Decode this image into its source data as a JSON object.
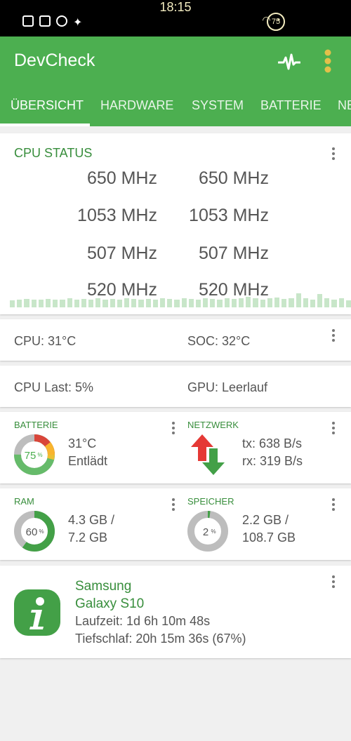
{
  "status_bar": {
    "time": "18:15",
    "battery_level": "75"
  },
  "app": {
    "title": "DevCheck",
    "brand_color": "#4caf50",
    "accent_dark": "#388e3c"
  },
  "tabs": [
    {
      "label": "ÜBERSICHT",
      "active": true
    },
    {
      "label": "HARDWARE"
    },
    {
      "label": "SYSTEM"
    },
    {
      "label": "BATTERIE"
    },
    {
      "label": "NE"
    }
  ],
  "cpu_status": {
    "title": "CPU STATUS",
    "frequencies": [
      "650 MHz",
      "650 MHz",
      "1053 MHz",
      "1053 MHz",
      "507 MHz",
      "507 MHz",
      "520 MHz",
      "520 MHz"
    ],
    "load_history": [
      0.45,
      0.5,
      0.55,
      0.5,
      0.5,
      0.55,
      0.5,
      0.5,
      0.6,
      0.5,
      0.55,
      0.5,
      0.6,
      0.5,
      0.55,
      0.5,
      0.6,
      0.55,
      0.5,
      0.55,
      0.5,
      0.6,
      0.55,
      0.5,
      0.6,
      0.55,
      0.5,
      0.6,
      0.55,
      0.5,
      0.6,
      0.55,
      0.6,
      0.7,
      0.6,
      0.5,
      0.6,
      0.65,
      0.55,
      0.6,
      0.9,
      0.6,
      0.5,
      0.85,
      0.6,
      0.5,
      0.6,
      0.45
    ]
  },
  "temps": {
    "cpu": "CPU: 31°C",
    "soc": "SOC: 32°C"
  },
  "load": {
    "cpu": "CPU Last: 5%",
    "gpu": "GPU: Leerlauf"
  },
  "battery": {
    "title": "BATTERIE",
    "percent": 75,
    "percent_label": "75",
    "percent_sign": "%",
    "temp": "31°C",
    "state": "Entlädt"
  },
  "network": {
    "title": "NETZWERK",
    "tx": "tx: 638 B/s",
    "rx": "rx: 319 B/s"
  },
  "ram": {
    "title": "RAM",
    "percent": 60,
    "percent_label": "60",
    "percent_sign": "%",
    "used": "4.3 GB /",
    "total": "7.2 GB"
  },
  "storage": {
    "title": "SPEICHER",
    "percent": 2,
    "percent_label": "2",
    "percent_sign": "%",
    "used": "2.2 GB /",
    "total": "108.7 GB"
  },
  "device": {
    "brand": "Samsung",
    "model": "Galaxy S10",
    "uptime": "Laufzeit: 1d 6h 10m 48s",
    "deep_sleep": "Tiefschlaf: 20h 15m 36s (67%)"
  }
}
